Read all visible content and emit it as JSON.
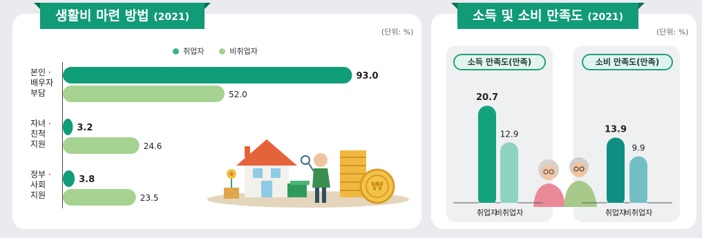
{
  "left": {
    "title": "생활비 마련 방법",
    "year": "(2021)",
    "unit": "(단위: %)",
    "legend": [
      {
        "label": "취업자",
        "color": "#3cb38f"
      },
      {
        "label": "비취업자",
        "color": "#a3d28f"
      }
    ],
    "categories": [
      {
        "lines": [
          "본인 ·",
          "배우자",
          "부담"
        ]
      },
      {
        "lines": [
          "자녀 ·",
          "친척",
          "지원"
        ]
      },
      {
        "lines": [
          "정부 ·",
          "사회",
          "지원"
        ]
      }
    ]
  },
  "right": {
    "title": "소득 및 소비 만족도",
    "year": "(2021)",
    "unit": "(단위: %)",
    "income": {
      "title": "소득 만족도(만족)"
    },
    "consumption": {
      "title": "소비 만족도(만족)"
    }
  },
  "chart_data": [
    {
      "type": "bar",
      "orientation": "horizontal",
      "title": "생활비 마련 방법 (2021)",
      "unit": "%",
      "categories": [
        "본인 · 배우자 부담",
        "자녀 · 친척 지원",
        "정부 · 사회 지원"
      ],
      "series": [
        {
          "name": "취업자",
          "values": [
            93.0,
            3.2,
            3.8
          ],
          "color": "#0f9e78"
        },
        {
          "name": "비취업자",
          "values": [
            52.0,
            24.6,
            23.5
          ],
          "color": "#a6d391"
        }
      ],
      "xlim": [
        0,
        100
      ]
    },
    {
      "type": "bar",
      "title": "소득 만족도(만족)",
      "unit": "%",
      "categories": [
        "취업자",
        "비취업자"
      ],
      "values": [
        20.7,
        12.9
      ],
      "colors": [
        "#13a27c",
        "#8ed2c2"
      ],
      "ylim": [
        0,
        25
      ]
    },
    {
      "type": "bar",
      "title": "소비 만족도(만족)",
      "unit": "%",
      "categories": [
        "취업자",
        "비취업자"
      ],
      "values": [
        13.9,
        9.9
      ],
      "colors": [
        "#0e8f82",
        "#74bfc4"
      ],
      "ylim": [
        0,
        25
      ]
    }
  ]
}
